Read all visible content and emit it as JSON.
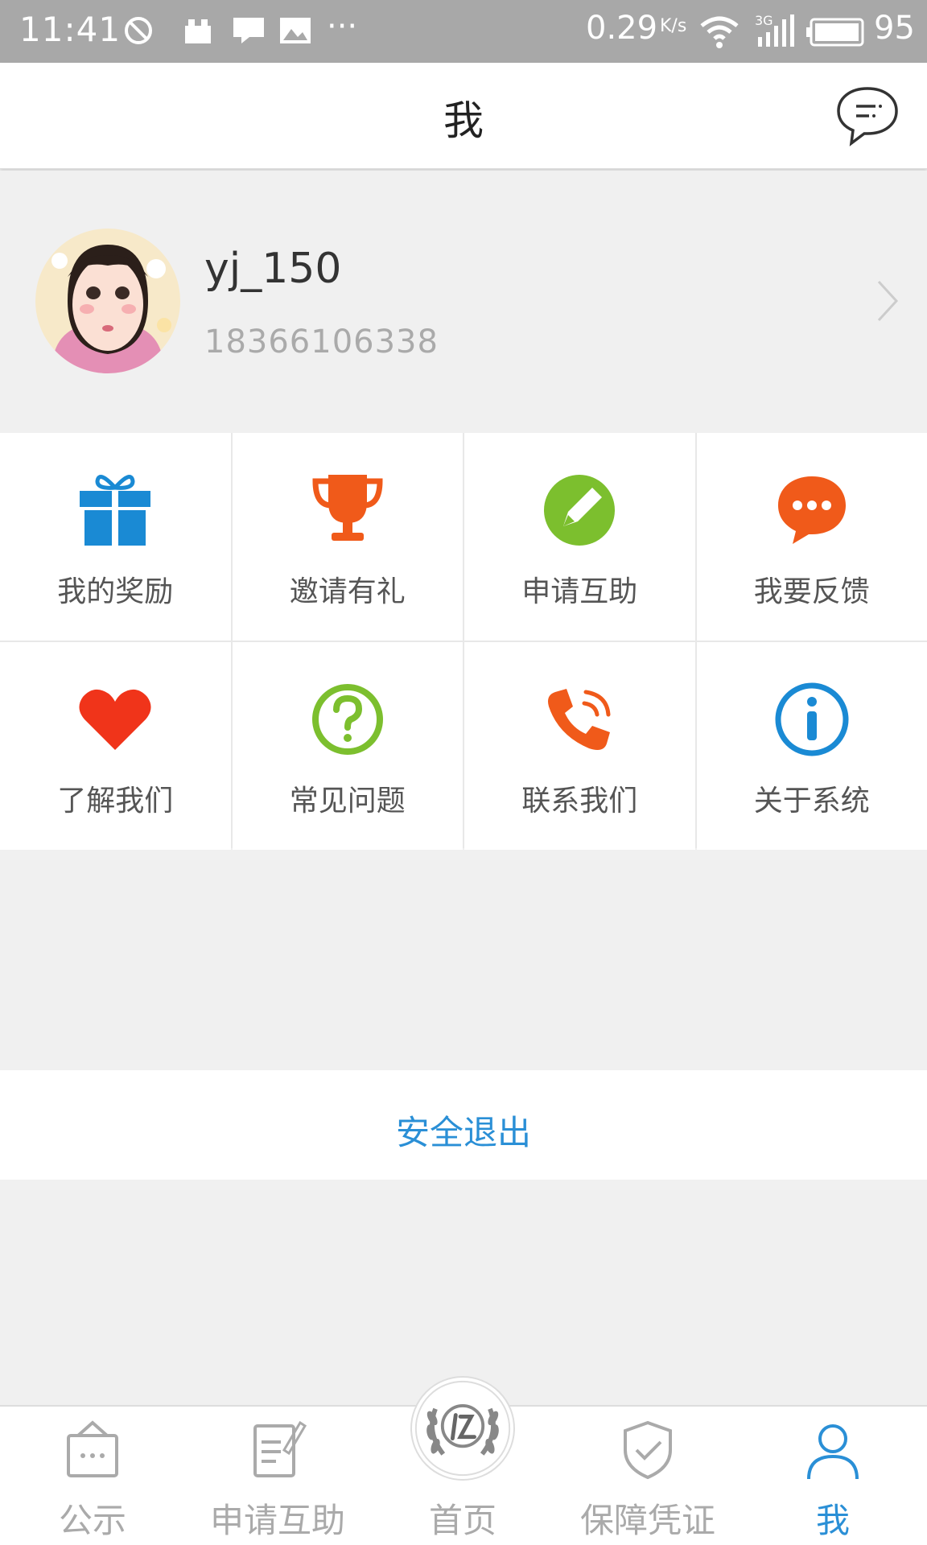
{
  "status_bar": {
    "time": "11:41",
    "speed": "0.29",
    "speed_unit": "K/s",
    "network": "3G",
    "battery": "95"
  },
  "header": {
    "title": "我"
  },
  "profile": {
    "username": "yj_150",
    "phone": "18366106338"
  },
  "menu": {
    "items": [
      {
        "label": "我的奖励",
        "icon": "gift-icon",
        "color": "#1a8ad4"
      },
      {
        "label": "邀请有礼",
        "icon": "trophy-icon",
        "color": "#f05a1a"
      },
      {
        "label": "申请互助",
        "icon": "pen-circle-icon",
        "color": "#7cbf2e"
      },
      {
        "label": "我要反馈",
        "icon": "chat-dots-icon",
        "color": "#f05a1a"
      },
      {
        "label": "了解我们",
        "icon": "heart-icon",
        "color": "#f0341a"
      },
      {
        "label": "常见问题",
        "icon": "question-circle-icon",
        "color": "#7cbf2e"
      },
      {
        "label": "联系我们",
        "icon": "phone-icon",
        "color": "#f05a1a"
      },
      {
        "label": "关于系统",
        "icon": "info-circle-icon",
        "color": "#1a8ad4"
      }
    ]
  },
  "logout": {
    "label": "安全退出"
  },
  "tabbar": {
    "items": [
      {
        "label": "公示",
        "icon": "notice-board-icon"
      },
      {
        "label": "申请互助",
        "icon": "edit-document-icon"
      },
      {
        "label": "首页",
        "icon": "home-laurel-logo-icon"
      },
      {
        "label": "保障凭证",
        "icon": "shield-check-icon"
      },
      {
        "label": "我",
        "icon": "user-icon"
      }
    ],
    "active_index": 4,
    "active_color": "#2a8fd6"
  }
}
